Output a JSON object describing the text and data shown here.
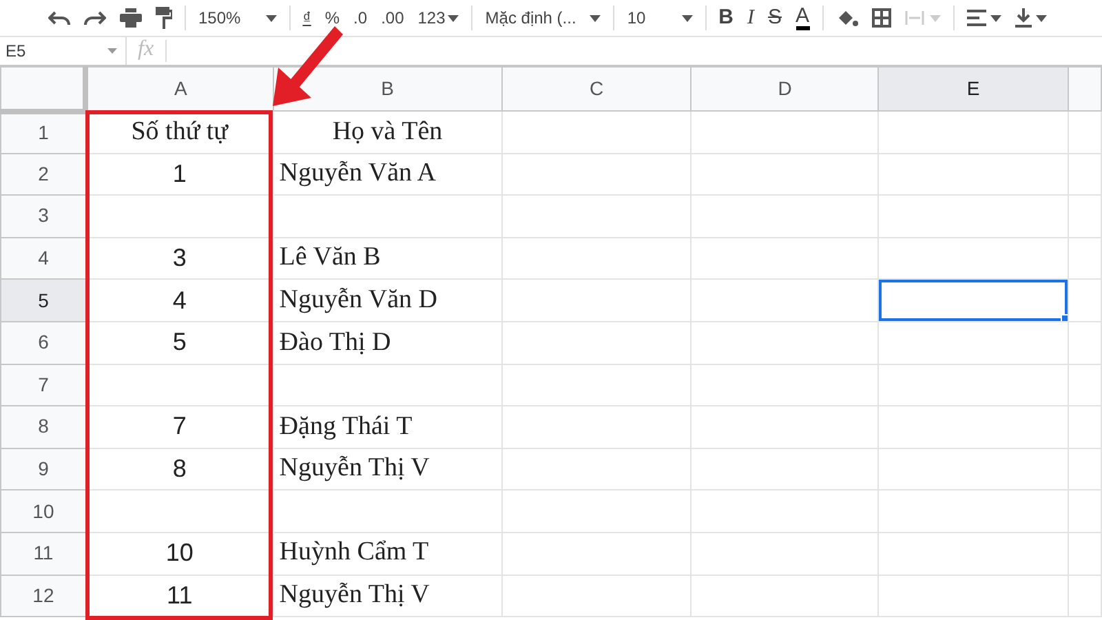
{
  "toolbar": {
    "zoom": "150%",
    "currency": "₫",
    "percent": "%",
    "decrease_decimal": ".0",
    "increase_decimal": ".00",
    "number_format": "123",
    "font": "Mặc định (...",
    "font_size": "10",
    "bold": "B",
    "italic": "I",
    "strikethrough": "S",
    "text_color": "A"
  },
  "name_box": "E5",
  "formula_label": "fx",
  "columns": [
    {
      "label": "A",
      "selected": false,
      "highlighted": true
    },
    {
      "label": "B",
      "selected": false,
      "highlighted": false
    },
    {
      "label": "C",
      "selected": false,
      "highlighted": false
    },
    {
      "label": "D",
      "selected": false,
      "highlighted": false
    },
    {
      "label": "E",
      "selected": true,
      "highlighted": false
    }
  ],
  "rows": [
    {
      "number": "1",
      "selected": false,
      "kind": "header",
      "a": "Số thứ tự",
      "b": "Họ và Tên"
    },
    {
      "number": "2",
      "selected": false,
      "kind": "data",
      "a": "1",
      "b": "Nguyễn Văn A"
    },
    {
      "number": "3",
      "selected": false,
      "kind": "data"
    },
    {
      "number": "4",
      "selected": false,
      "kind": "data",
      "a": "3",
      "b": "Lê Văn B"
    },
    {
      "number": "5",
      "selected": true,
      "kind": "data",
      "a": "4",
      "b": "Nguyễn Văn D"
    },
    {
      "number": "6",
      "selected": false,
      "kind": "data",
      "a": "5",
      "b": "Đào Thị D"
    },
    {
      "number": "7",
      "selected": false,
      "kind": "data"
    },
    {
      "number": "8",
      "selected": false,
      "kind": "data",
      "a": "7",
      "b": "Đặng Thái T"
    },
    {
      "number": "9",
      "selected": false,
      "kind": "data",
      "a": "8",
      "b": "Nguyễn Thị V"
    },
    {
      "number": "10",
      "selected": false,
      "kind": "data"
    },
    {
      "number": "11",
      "selected": false,
      "kind": "data",
      "a": "10",
      "b": "Huỳnh Cẩm T"
    },
    {
      "number": "12",
      "selected": false,
      "kind": "data",
      "a": "11",
      "b": "Nguyễn Thị V"
    }
  ]
}
